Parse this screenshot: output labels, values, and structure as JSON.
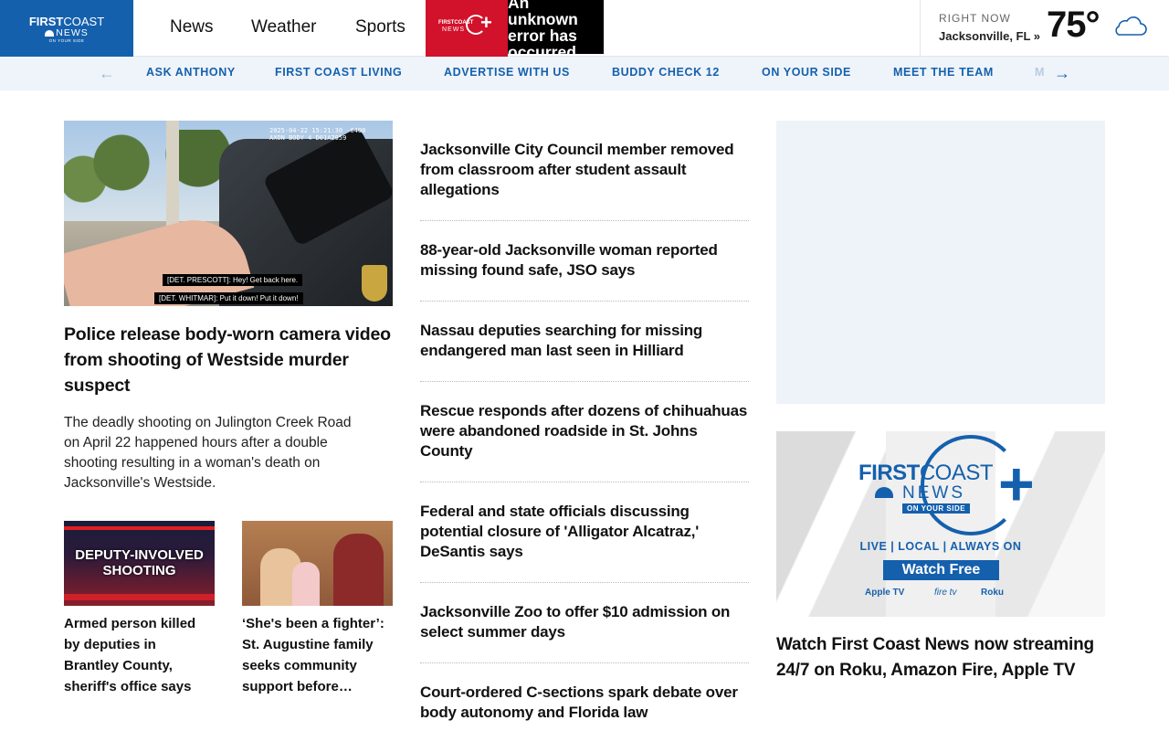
{
  "header": {
    "logo": {
      "line1_bold": "FIRST",
      "line1_thin": "COAST",
      "line2": "NEWS",
      "line3": "ON YOUR SIDE"
    },
    "nav": [
      "News",
      "Weather",
      "Sports"
    ],
    "plus_logo": {
      "line1": "FIRSTCOAST",
      "line2": "NEWS",
      "plus": "+"
    },
    "error_text": "An unknown error has occurred",
    "weather": {
      "label": "RIGHT NOW",
      "location": "Jacksonville, FL »",
      "temp": "75°",
      "icon": "cloud-icon"
    }
  },
  "subnav": {
    "prev_arrow": "←",
    "next_arrow": "→",
    "items": [
      "ASK ANTHONY",
      "FIRST COAST LIVING",
      "ADVERTISE WITH US",
      "BUDDY CHECK 12",
      "ON YOUR SIDE",
      "MEET THE TEAM"
    ],
    "partial_item": "M"
  },
  "hero": {
    "image_stamp_line1": "2025-04-22 15:21:30 -0400",
    "image_stamp_line2": "AXON BODY 4 D01A2959",
    "caption1": "[DET. PRESCOTT]: Hey! Get back here.",
    "caption2": "[DET. WHITMAR]: Put it down! Put it down!",
    "title": "Police release body-worn camera video from shooting of Westside murder suspect",
    "description": "The deadly shooting on Julington Creek Road on April 22 happened hours after a double shooting resulting in a woman's death on Jacksonville's Westside."
  },
  "thumbs": [
    {
      "overlay": "DEPUTY-INVOLVED SHOOTING",
      "title": "Armed person killed by deputies in Brantley County, sheriff's office says"
    },
    {
      "overlay": "",
      "title": "‘She's been a fighter’: St. Augustine family seeks community support before…"
    }
  ],
  "stories": [
    "Jacksonville City Council member removed from classroom after student assault allegations",
    "88-year-old Jacksonville woman reported missing found safe, JSO says",
    "Nassau deputies searching for missing endangered man last seen in Hilliard",
    "Rescue responds after dozens of chihuahuas were abandoned roadside in St. Johns County",
    "Federal and state officials discussing potential closure of 'Alligator Alcatraz,' DeSantis says",
    "Jacksonville Zoo to offer $10 admission on select summer days",
    "Court-ordered C-sections spark debate over body autonomy and Florida law"
  ],
  "promo": {
    "brand_bold": "FIRST",
    "brand_thin": "COAST",
    "brand_news": "NEWS",
    "brand_side": "ON YOUR SIDE",
    "plus": "+",
    "tagline": "LIVE | LOCAL | ALWAYS ON",
    "cta": "Watch Free",
    "platforms": [
      "Apple TV",
      "fire tv",
      "Roku"
    ],
    "title": "Watch First Coast News now streaming 24/7 on Roku, Amazon Fire, Apple TV"
  },
  "colors": {
    "brand_blue": "#1560ad",
    "plus_red": "#d2112a",
    "subnav_bg": "#eef4fa"
  }
}
